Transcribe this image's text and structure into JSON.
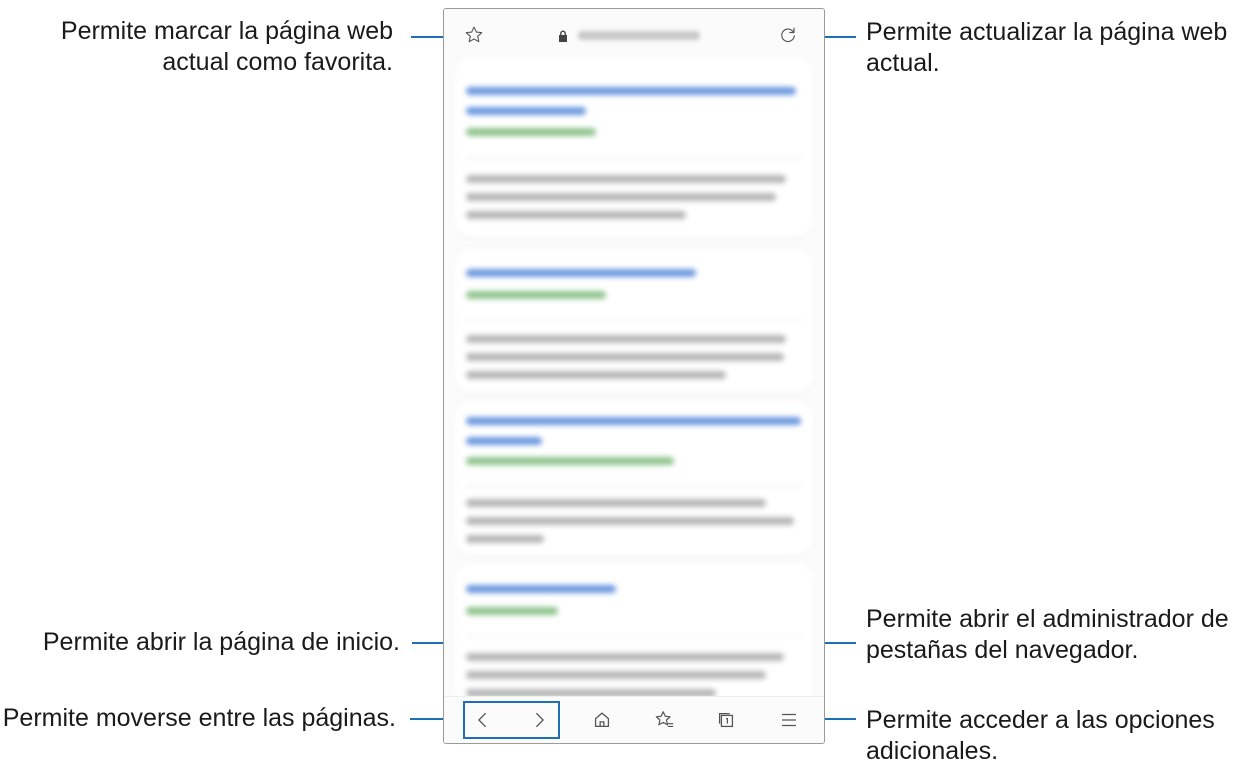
{
  "callouts": {
    "bookmark": {
      "line1": "Permite marcar la página web",
      "line2": "actual como favorita."
    },
    "refresh": {
      "line1": "Permite actualizar la página web",
      "line2": "actual."
    },
    "home": {
      "line1": "Permite abrir la página de inicio."
    },
    "tabs": {
      "line1": "Permite abrir el administrador de",
      "line2": "pestañas del navegador."
    },
    "navigate": {
      "line1": "Permite moverse entre las páginas."
    },
    "options": {
      "line1": "Permite acceder a las opciones",
      "line2": "adicionales."
    }
  },
  "browser": {
    "icons": {
      "top": [
        "star-icon",
        "lock-icon",
        "refresh-icon"
      ],
      "bottom": [
        "back-icon",
        "forward-icon",
        "home-icon",
        "bookmarks-icon",
        "tabs-icon",
        "menu-icon"
      ]
    }
  },
  "colors": {
    "callout_line": "#1f6fb7",
    "blurred_link": "#6c99e0",
    "blurred_url": "#8fc48e"
  }
}
